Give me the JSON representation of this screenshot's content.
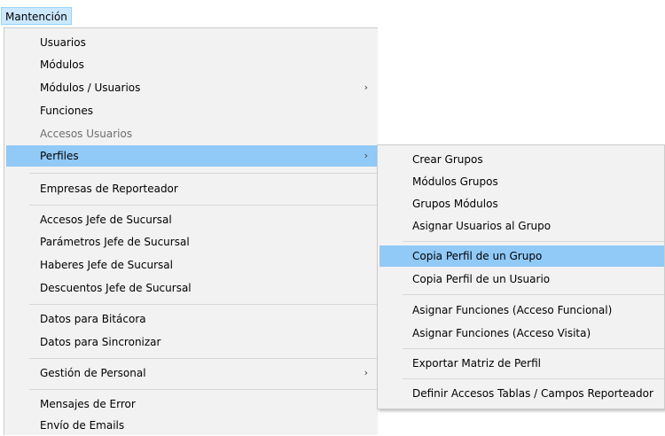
{
  "menubar": {
    "title": "Mantención"
  },
  "main_menu": {
    "items": [
      {
        "label": "Usuarios"
      },
      {
        "label": "Módulos"
      },
      {
        "label": "Módulos / Usuarios",
        "submenu_arrow": "›"
      },
      {
        "label": "Funciones"
      },
      {
        "label": "Accesos Usuarios",
        "disabled": true
      },
      {
        "label": "Perfiles",
        "submenu_arrow": "›",
        "highlighted": true
      },
      {
        "label": "Empresas de Reporteador"
      },
      {
        "label": "Accesos Jefe de Sucursal"
      },
      {
        "label": "Parámetros Jefe de Sucursal"
      },
      {
        "label": "Haberes Jefe de Sucursal"
      },
      {
        "label": "Descuentos Jefe de Sucursal"
      },
      {
        "label": "Datos para Bitácora"
      },
      {
        "label": "Datos para Sincronizar"
      },
      {
        "label": "Gestión de Personal",
        "submenu_arrow": "›"
      },
      {
        "label": "Mensajes de Error"
      },
      {
        "label": "Envío de Emails"
      }
    ]
  },
  "sub_menu": {
    "items": [
      {
        "label": "Crear Grupos"
      },
      {
        "label": "Módulos Grupos"
      },
      {
        "label": "Grupos Módulos"
      },
      {
        "label": "Asignar Usuarios al Grupo"
      },
      {
        "label": "Copia Perfil de un Grupo",
        "highlighted": true
      },
      {
        "label": "Copia Perfil de un Usuario"
      },
      {
        "label": "Asignar Funciones (Acceso Funcional)"
      },
      {
        "label": "Asignar Funciones (Acceso Visita)"
      },
      {
        "label": "Exportar Matriz de Perfil"
      },
      {
        "label": "Definir Accesos Tablas / Campos Reporteador"
      }
    ]
  },
  "colors": {
    "menu_background": "#f2f2f2",
    "highlight": "#91c9f7",
    "menubar_highlight": "#cce8ff",
    "disabled_text": "#6d6d6d"
  }
}
